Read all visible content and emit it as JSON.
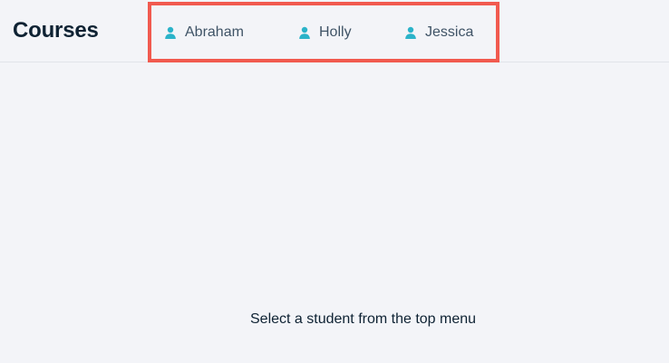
{
  "header": {
    "title": "Courses"
  },
  "student_menu": {
    "items": [
      {
        "label": "Abraham",
        "icon": "person-icon"
      },
      {
        "label": "Holly",
        "icon": "person-icon"
      },
      {
        "label": "Jessica",
        "icon": "person-icon"
      }
    ]
  },
  "main": {
    "empty_message": "Select a student from the top menu"
  },
  "colors": {
    "background": "#f3f4f8",
    "title_text": "#0e2233",
    "menu_text": "#3f5366",
    "icon_accent": "#2bb3c9",
    "highlight_border": "#f15a4f"
  }
}
